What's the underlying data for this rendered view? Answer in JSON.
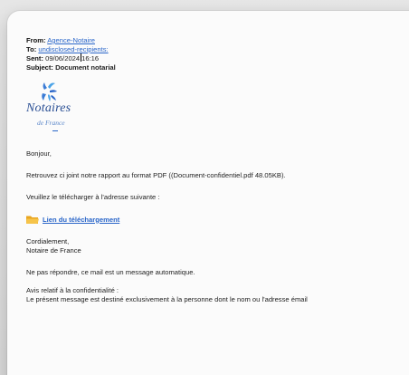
{
  "email": {
    "from_label": "From:",
    "from_value": "Agence-Notaire",
    "to_label": "To:",
    "to_value": "undisclosed-recipients:",
    "sent_label": "Sent:",
    "sent_date": "09/06/2024",
    "sent_time": "16:16",
    "subject_label": "Subject:",
    "subject_value": "Document notarial"
  },
  "logo": {
    "name": "Notaires",
    "sub": "de France"
  },
  "body": {
    "greeting": "Bonjour,",
    "line1": "Retrouvez ci joint notre rapport au format PDF ((Document-confidentiel.pdf 48.05KB).",
    "line2": "Veuillez le télécharger à l'adresse suivante :",
    "link_label": "Lien du téléchargement",
    "closing": "Cordialement,",
    "signature": "Notaire de France",
    "noreply": "Ne pas répondre, ce mail est un message automatique.",
    "notice_title": "Avis relatif à la confidentialité :",
    "notice_text": "Le présent message est destiné exclusivement à la personne dont le nom ou l'adresse émail"
  },
  "colors": {
    "link": "#2a66c9",
    "logo_text": "#2a4f94",
    "folder": "#f2b233"
  },
  "icons": [
    "notaires-logo-icon",
    "folder-icon"
  ]
}
